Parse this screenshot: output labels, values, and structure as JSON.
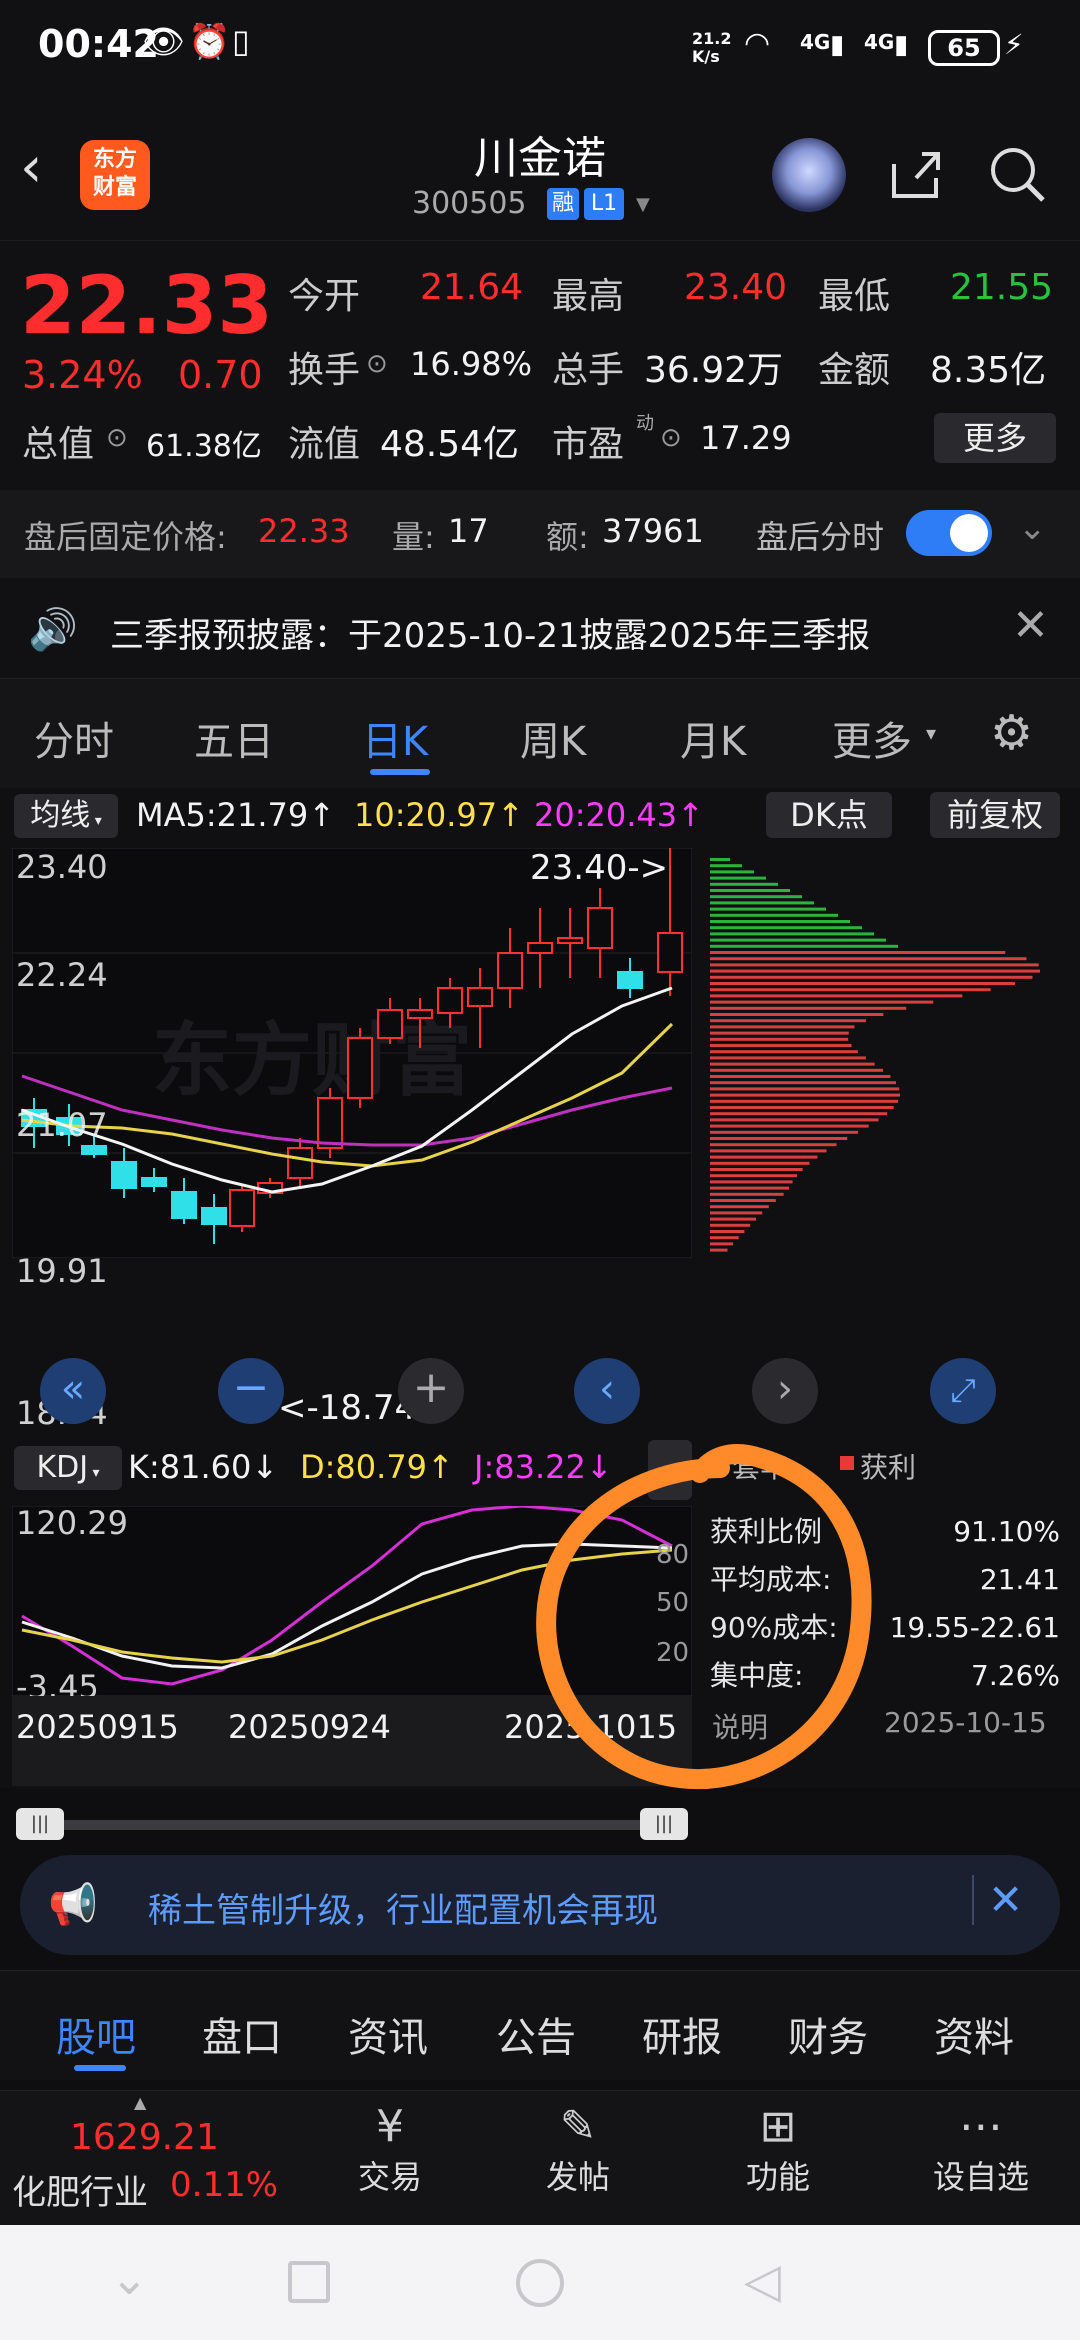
{
  "status": {
    "time": "00:42",
    "speed": "21.2\nK/s",
    "net1": "4G",
    "net2": "4G",
    "battery": "65"
  },
  "nav": {
    "logo_text": "东方\n财富",
    "name": "川金诺",
    "code": "300505",
    "badge_rong": "融",
    "badge_l1": "L1"
  },
  "quote": {
    "price": "22.33",
    "pct": "3.24%",
    "change": "0.70",
    "open_label": "今开",
    "open": "21.64",
    "high_label": "最高",
    "high": "23.40",
    "low_label": "最低",
    "low": "21.55",
    "turn_label": "换手",
    "turn": "16.98%",
    "vol_label": "总手",
    "vol": "36.92万",
    "amt_label": "金额",
    "amt": "8.35亿",
    "mcap_label": "总值",
    "mcap": "61.38亿",
    "float_label": "流值",
    "float": "48.54亿",
    "pe_label": "市盈",
    "pe_sup": "动",
    "pe": "17.29",
    "more": "更多"
  },
  "after": {
    "label": "盘后固定价格:",
    "price": "22.33",
    "vol_label": "量:",
    "vol": "17",
    "amt_label": "额:",
    "amt": "37961",
    "switch_label": "盘后分时"
  },
  "notice": {
    "text": "三季报预披露：于2025-10-21披露2025年三季报"
  },
  "tabs": [
    "分时",
    "五日",
    "日K",
    "周K",
    "月K",
    "更多"
  ],
  "active_tab": "日K",
  "ma_bar": {
    "label": "均线",
    "ma5": "MA5:21.79↑",
    "ma10": "10:20.97↑",
    "ma20": "20:20.43↑",
    "dk": "DK点",
    "fq": "前复权"
  },
  "kline": {
    "y_labels": [
      "23.40",
      "22.24",
      "21.07",
      "19.91",
      "18.74"
    ],
    "high_ann": "23.40->",
    "low_ann": "<-18.74",
    "watermark": "东方财富"
  },
  "kdj_bar": {
    "label": "KDJ",
    "k": "K:81.60↓",
    "d": "D:80.79↑",
    "j": "J:83.22↓"
  },
  "kdj": {
    "y_top": "120.29",
    "y_bot": "-3.45",
    "r80": "80",
    "r50": "50",
    "r20": "20"
  },
  "xaxis": [
    "20250915",
    "20250924",
    "2025 1015"
  ],
  "chip": {
    "legend_a": "套牢",
    "legend_b": "获利",
    "rows": [
      [
        "获利比例",
        "91.10%"
      ],
      [
        "平均成本:",
        "21.41"
      ],
      [
        "90%成本:",
        "19.55-22.61"
      ],
      [
        "集中度:",
        "7.26%"
      ]
    ],
    "note": "说明",
    "date": "2025-10-15"
  },
  "ad": {
    "text": "稀土管制升级，行业配置机会再现"
  },
  "subtabs": [
    "股吧",
    "盘口",
    "资讯",
    "公告",
    "研报",
    "财务",
    "资料"
  ],
  "bottom": {
    "index_val": "1629.21",
    "index_name": "化肥行业",
    "index_pct": "0.11%",
    "trade": "交易",
    "post": "发帖",
    "func": "功能",
    "watch": "设自选"
  },
  "colors": {
    "up": "#ff2d2d",
    "down": "#27c43b",
    "accent": "#2f7df6",
    "annot": "#ff8a2a"
  }
}
